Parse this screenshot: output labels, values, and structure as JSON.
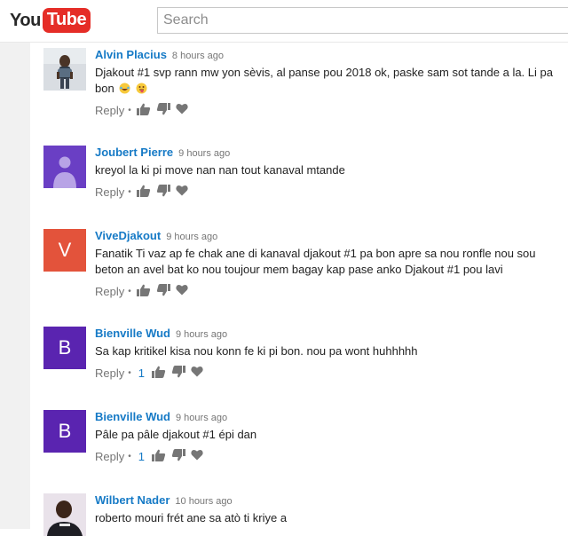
{
  "header": {
    "logo_you": "You",
    "logo_tube": "Tube",
    "search_placeholder": "Search"
  },
  "actions": {
    "reply_label": "Reply",
    "separator": "•"
  },
  "comments": [
    {
      "author": "Alvin Placius",
      "time": "8 hours ago",
      "text": "Djakout #1 svp rann mw yon sèvis, al panse pou 2018 ok, paske sam sot tande a la. Li pa bon",
      "avatar_type": "photo",
      "emoji": [
        "laughing-tears-emoji",
        "tongue-emoji"
      ]
    },
    {
      "author": "Joubert Pierre",
      "time": "9 hours ago",
      "text": "kreyol la ki pi move nan nan tout kanaval mtande",
      "avatar_type": "default-person",
      "avatar_color": "#6a3fc4"
    },
    {
      "author": "ViveDjakout",
      "time": "9 hours ago",
      "text": "Fanatik Ti vaz ap fe chak ane di kanaval djakout #1 pa bon apre sa nou ronfle nou sou beton an avel bat ko nou toujour mem bagay kap pase anko Djakout #1 pou lavi",
      "avatar_type": "letter",
      "avatar_letter": "V",
      "avatar_color": "#e3533b"
    },
    {
      "author": "Bienville Wud",
      "time": "9 hours ago",
      "text": "Sa kap kritikel kisa nou konn fe ki pi bon. nou pa wont huhhhhh",
      "avatar_type": "letter",
      "avatar_letter": "B",
      "avatar_color": "#5a24b0",
      "likes": "1"
    },
    {
      "author": "Bienville Wud",
      "time": "9 hours ago",
      "text": "Pâle pa pâle djakout #1 épi dan",
      "avatar_type": "letter",
      "avatar_letter": "B",
      "avatar_color": "#5a24b0",
      "likes": "1"
    },
    {
      "author": "Wilbert Nader",
      "time": "10 hours ago",
      "text": "roberto mouri frét ane sa atò ti kriye a",
      "avatar_type": "photo"
    }
  ]
}
